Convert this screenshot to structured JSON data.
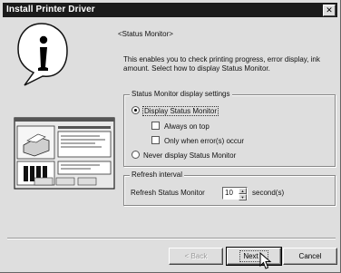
{
  "window": {
    "title": "Install Printer Driver",
    "close_glyph": "✕"
  },
  "heading": "<Status Monitor>",
  "description": "This enables you to check printing progress, error display, ink amount. Select how to display Status Monitor.",
  "display_settings": {
    "legend": "Status Monitor display settings",
    "display_option": "Display Status Monitor",
    "always_on_top": "Always on top",
    "only_when_error": "Only when error(s) occur",
    "never_option": "Never display Status Monitor",
    "selected": "display",
    "always_on_top_checked": false,
    "only_when_error_checked": false
  },
  "refresh": {
    "legend": "Refresh interval",
    "label": "Refresh Status Monitor",
    "value": "10",
    "unit": "second(s)"
  },
  "buttons": {
    "back": "< Back",
    "next": "Next >",
    "cancel": "Cancel"
  },
  "icons": {
    "info": "i",
    "spin_up": "▲",
    "spin_down": "▼"
  }
}
